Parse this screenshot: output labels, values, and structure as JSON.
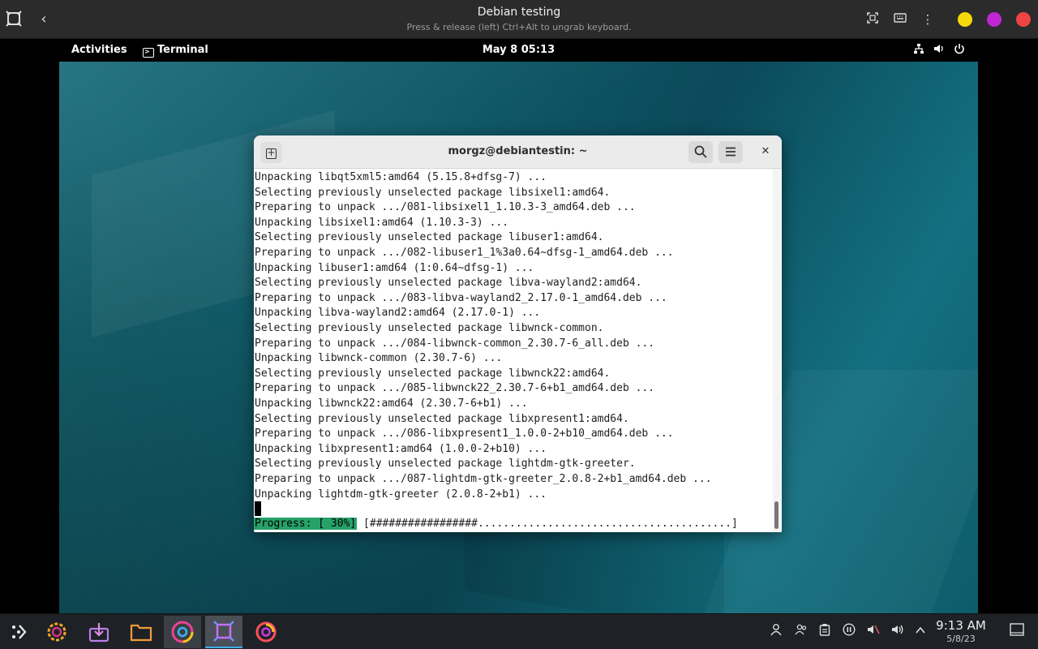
{
  "host": {
    "title": "Debian testing",
    "subtitle": "Press & release (left) Ctrl+Alt to ungrab keyboard.",
    "dot_colors": [
      "#f5d90a",
      "#c026d3",
      "#ef4444"
    ]
  },
  "gnome_panel": {
    "activities": "Activities",
    "app_name": "Terminal",
    "clock": "May 8  05:13"
  },
  "terminal": {
    "title": "morgz@debiantestin: ~",
    "lines": [
      "Unpacking libqt5xml5:amd64 (5.15.8+dfsg-7) ...",
      "Selecting previously unselected package libsixel1:amd64.",
      "Preparing to unpack .../081-libsixel1_1.10.3-3_amd64.deb ...",
      "Unpacking libsixel1:amd64 (1.10.3-3) ...",
      "Selecting previously unselected package libuser1:amd64.",
      "Preparing to unpack .../082-libuser1_1%3a0.64~dfsg-1_amd64.deb ...",
      "Unpacking libuser1:amd64 (1:0.64~dfsg-1) ...",
      "Selecting previously unselected package libva-wayland2:amd64.",
      "Preparing to unpack .../083-libva-wayland2_2.17.0-1_amd64.deb ...",
      "Unpacking libva-wayland2:amd64 (2.17.0-1) ...",
      "Selecting previously unselected package libwnck-common.",
      "Preparing to unpack .../084-libwnck-common_2.30.7-6_all.deb ...",
      "Unpacking libwnck-common (2.30.7-6) ...",
      "Selecting previously unselected package libwnck22:amd64.",
      "Preparing to unpack .../085-libwnck22_2.30.7-6+b1_amd64.deb ...",
      "Unpacking libwnck22:amd64 (2.30.7-6+b1) ...",
      "Selecting previously unselected package libxpresent1:amd64.",
      "Preparing to unpack .../086-libxpresent1_1.0.0-2+b10_amd64.deb ...",
      "Unpacking libxpresent1:amd64 (1.0.0-2+b10) ...",
      "Selecting previously unselected package lightdm-gtk-greeter.",
      "Preparing to unpack .../087-lightdm-gtk-greeter_2.0.8-2+b1_amd64.deb ...",
      "Unpacking lightdm-gtk-greeter (2.0.8-2+b1) ..."
    ],
    "progress_label": "Progress: [ 30%]",
    "progress_bar": " [#################........................................]",
    "progress_percent": 30
  },
  "taskbar": {
    "time": "9:13 AM",
    "date": "5/8/23"
  }
}
